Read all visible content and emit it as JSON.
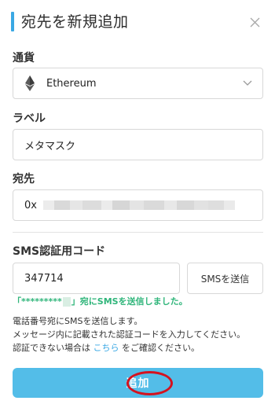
{
  "header": {
    "title": "宛先を新規追加",
    "close_icon": "×"
  },
  "currency": {
    "label": "通貨",
    "selected": "Ethereum"
  },
  "label_field": {
    "label": "ラベル",
    "value": "メタマスク"
  },
  "destination": {
    "label": "宛先",
    "value_prefix": "0x"
  },
  "sms": {
    "label": "SMS認証用コード",
    "code_value": "347714",
    "send_button": "SMSを送信",
    "sent_prefix": "「*********",
    "sent_suffix": "」宛にSMSを送信しました。"
  },
  "note": {
    "line1": "電話番号宛にSMSを送信します。",
    "line2": "メッセージ内に記載された認証コードを入力してください。",
    "line3_prefix": "認証できない場合は ",
    "line3_link": "こちら",
    "line3_suffix": " をご確認ください。"
  },
  "submit": {
    "label": "追加"
  },
  "colors": {
    "accent": "#3aa8e4",
    "button": "#53bde8",
    "success": "#2fb57a",
    "annotation": "#d4121f"
  }
}
